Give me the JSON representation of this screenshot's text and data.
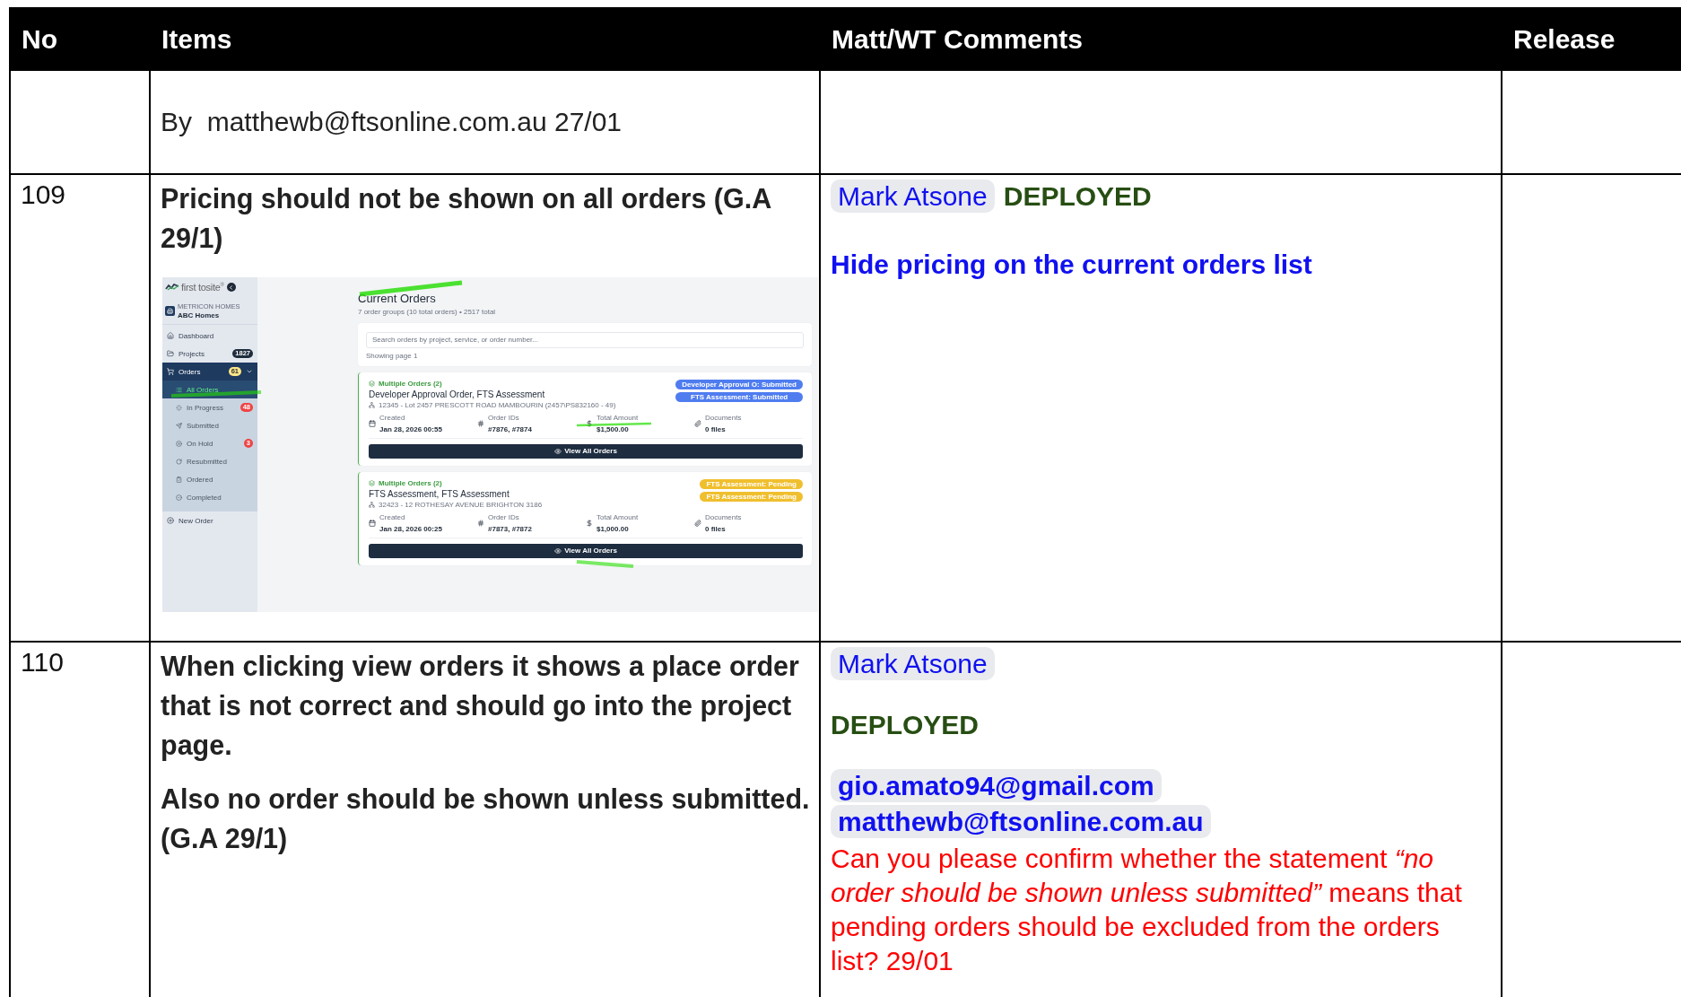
{
  "table": {
    "columns": [
      "No",
      "Items",
      "Matt/WT Comments",
      "Release"
    ],
    "rows": [
      {
        "byline": "By  matthewb@ftsonline.com.au 27/01"
      },
      {
        "no": "109",
        "paragraphs": [
          "Pricing should not be shown on all orders (G.A 29/1)"
        ],
        "screenshot": {
          "logo": "first tosite$^{®}$",
          "org": {
            "label": "METRICON HOMES",
            "name": "ABC Homes"
          },
          "nav": [
            {
              "label": "Dashboard",
              "selected": false
            },
            {
              "label": "Projects",
              "selected": false,
              "badge": {
                "text": "1827",
                "color": "#1f2d3d"
              }
            },
            {
              "label": "Orders",
              "selected": true,
              "expanded": true,
              "badge": {
                "text": "61",
                "color": "#fde68a"
              },
              "children": [
                {
                  "label": "All Orders",
                  "selected": true
                },
                {
                  "label": "In Progress",
                  "selected": false,
                  "badge": {
                    "text": "48",
                    "color": "#ef4444"
                  }
                },
                {
                  "label": "Submitted",
                  "selected": false
                },
                {
                  "label": "On Hold",
                  "selected": false,
                  "badge": {
                    "text": "3",
                    "color": "#ef4444"
                  }
                },
                {
                  "label": "Resubmitted",
                  "selected": false
                },
                {
                  "label": "Ordered",
                  "selected": false
                },
                {
                  "label": "Completed",
                  "selected": false
                }
              ]
            },
            {
              "label": "New Order",
              "selected": false
            }
          ],
          "title": "Current Orders",
          "subtitle": "7 order groups (10 total orders) • 2517 total",
          "search": {
            "placeholder": "Search orders by project, service, or order number..."
          },
          "paging": "Showing page 1",
          "orders": [
            {
              "group": "Multiple Orders (2)",
              "title": "Developer Approval Order, FTS Assessment",
              "address": "12345 - Lot 2457 PRESCOTT ROAD MAMBOURIN (2457\\PS832160 - 49)",
              "statuses": [
                {
                  "label": "Developer Approval O: Submitted",
                  "color": "#4f7df0"
                },
                {
                  "label": "FTS Assessment: Submitted",
                  "color": "#4f7df0"
                }
              ],
              "fields": [
                {
                  "label": "Created",
                  "value": "Jan 28, 2026 00:55"
                },
                {
                  "label": "Order IDs",
                  "value": "#7876, #7874"
                },
                {
                  "label": "Total Amount",
                  "value": "$1,500.00"
                },
                {
                  "label": "Documents",
                  "value": "0 files"
                }
              ],
              "button": "View All Orders"
            },
            {
              "group": "Multiple Orders (2)",
              "title": "FTS Assessment, FTS Assessment",
              "address": "32423 - 12 ROTHESAY AVENUE BRIGHTON 3186",
              "statuses": [
                {
                  "label": "FTS Assessment: Pending",
                  "color": "#f0bf2e"
                },
                {
                  "label": "FTS Assessment: Pending",
                  "color": "#f0bf2e"
                }
              ],
              "fields": [
                {
                  "label": "Created",
                  "value": "Jan 28, 2026 00:25"
                },
                {
                  "label": "Order IDs",
                  "value": "#7873, #7872"
                },
                {
                  "label": "Total Amount",
                  "value": "$1,000.00"
                },
                {
                  "label": "Documents",
                  "value": "0 files"
                }
              ],
              "button": "View All Orders"
            }
          ]
        },
        "comments": [
          [
            {
              "kind": "person",
              "text": "Mark Atsone"
            },
            {
              "kind": "status",
              "text": "DEPLOYED"
            }
          ],
          [
            {
              "kind": "note",
              "text": "Hide pricing on the current orders list"
            }
          ]
        ]
      },
      {
        "no": "110",
        "paragraphs": [
          "When clicking view orders it shows a place order that is not correct and should go into the project page.",
          "Also no order should be shown unless submitted. (G.A 29/1)"
        ],
        "comments": [
          [
            {
              "kind": "person",
              "text": "Mark Atsone"
            }
          ],
          [
            {
              "kind": "status",
              "text": "DEPLOYED"
            }
          ],
          [
            {
              "kind": "mention",
              "text": "gio.amato94@gmail.com"
            },
            {
              "kind": "mention",
              "text": "matthewb@ftsonline.com.au"
            },
            {
              "kind": "question",
              "text": "Can you please confirm whether the statement *“no order should be shown unless submitted”* means that pending orders should be excluded from the orders list? 29/01"
            }
          ]
        ]
      }
    ]
  }
}
